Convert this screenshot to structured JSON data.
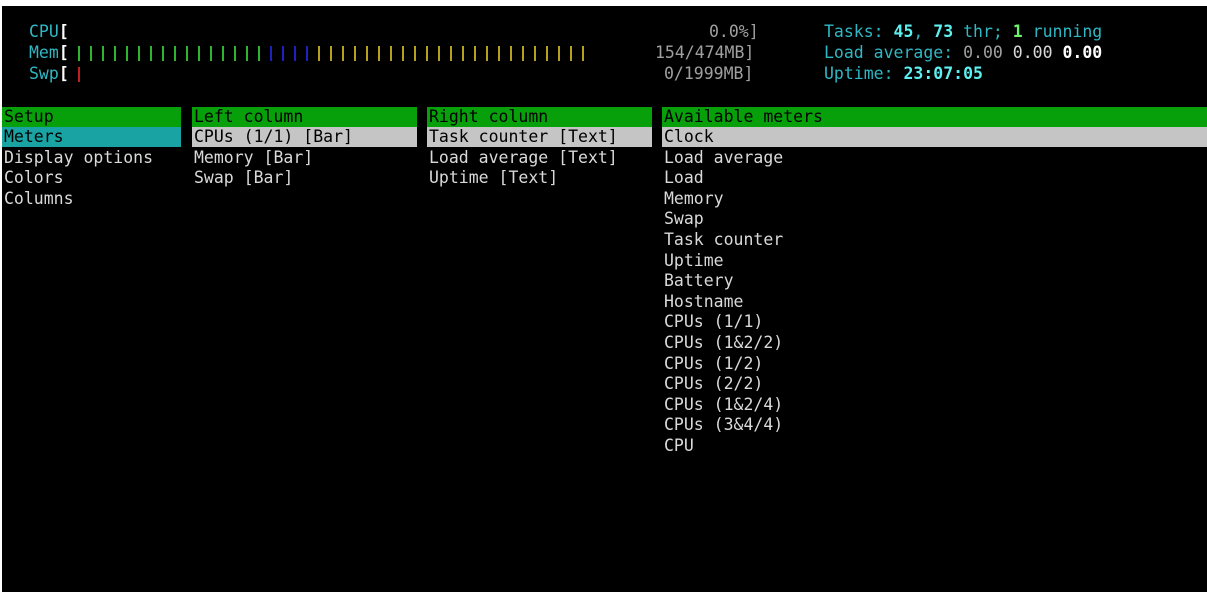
{
  "meters": {
    "cpu": {
      "label": "CPU",
      "open": "[",
      "value": "0.0%]"
    },
    "mem": {
      "label": "Mem",
      "open": "[",
      "value": "154/474MB]",
      "used_bars": 16,
      "buffer_bars": 4,
      "cache_bars": 23,
      "colors": {
        "used": "#2db52d",
        "buffer": "#2020c0",
        "cache": "#b5a020"
      }
    },
    "swp": {
      "label": "Swp",
      "open": "[",
      "value": "0/1999MB]",
      "bars": 1,
      "color": "#c02020"
    }
  },
  "summary": {
    "tasks_label": "Tasks: ",
    "tasks_count": "45",
    "sep": ", ",
    "threads": "73",
    "thr_label": " thr; ",
    "running": "1",
    "running_label": " running",
    "load_label": "Load average: ",
    "load1": "0.00",
    "load5": "0.00",
    "load15": "0.00",
    "uptime_label": "Uptime: ",
    "uptime": "23:07:05"
  },
  "setup": {
    "header": "Setup",
    "items": [
      "Meters",
      "Display options",
      "Colors",
      "Columns"
    ]
  },
  "left_column": {
    "header": "Left column",
    "items": [
      "CPUs (1/1) [Bar]",
      "Memory [Bar]",
      "Swap [Bar]"
    ]
  },
  "right_column": {
    "header": "Right column",
    "items": [
      "Task counter [Text]",
      "Load average [Text]",
      "Uptime [Text]"
    ]
  },
  "available": {
    "header": "Available meters",
    "items": [
      "Clock",
      "Load average",
      "Load",
      "Memory",
      "Swap",
      "Task counter",
      "Uptime",
      "Battery",
      "Hostname",
      "CPUs (1/1)",
      "CPUs (1&2/2)",
      "CPUs (1/2)",
      "CPUs (2/2)",
      "CPUs (1&2/4)",
      "CPUs (3&4/4)",
      "CPU"
    ]
  },
  "colors": {
    "header_bg": "#08a00a",
    "selected_cyan": "#1aa3a3",
    "selected_grey": "#c5c5c5"
  }
}
